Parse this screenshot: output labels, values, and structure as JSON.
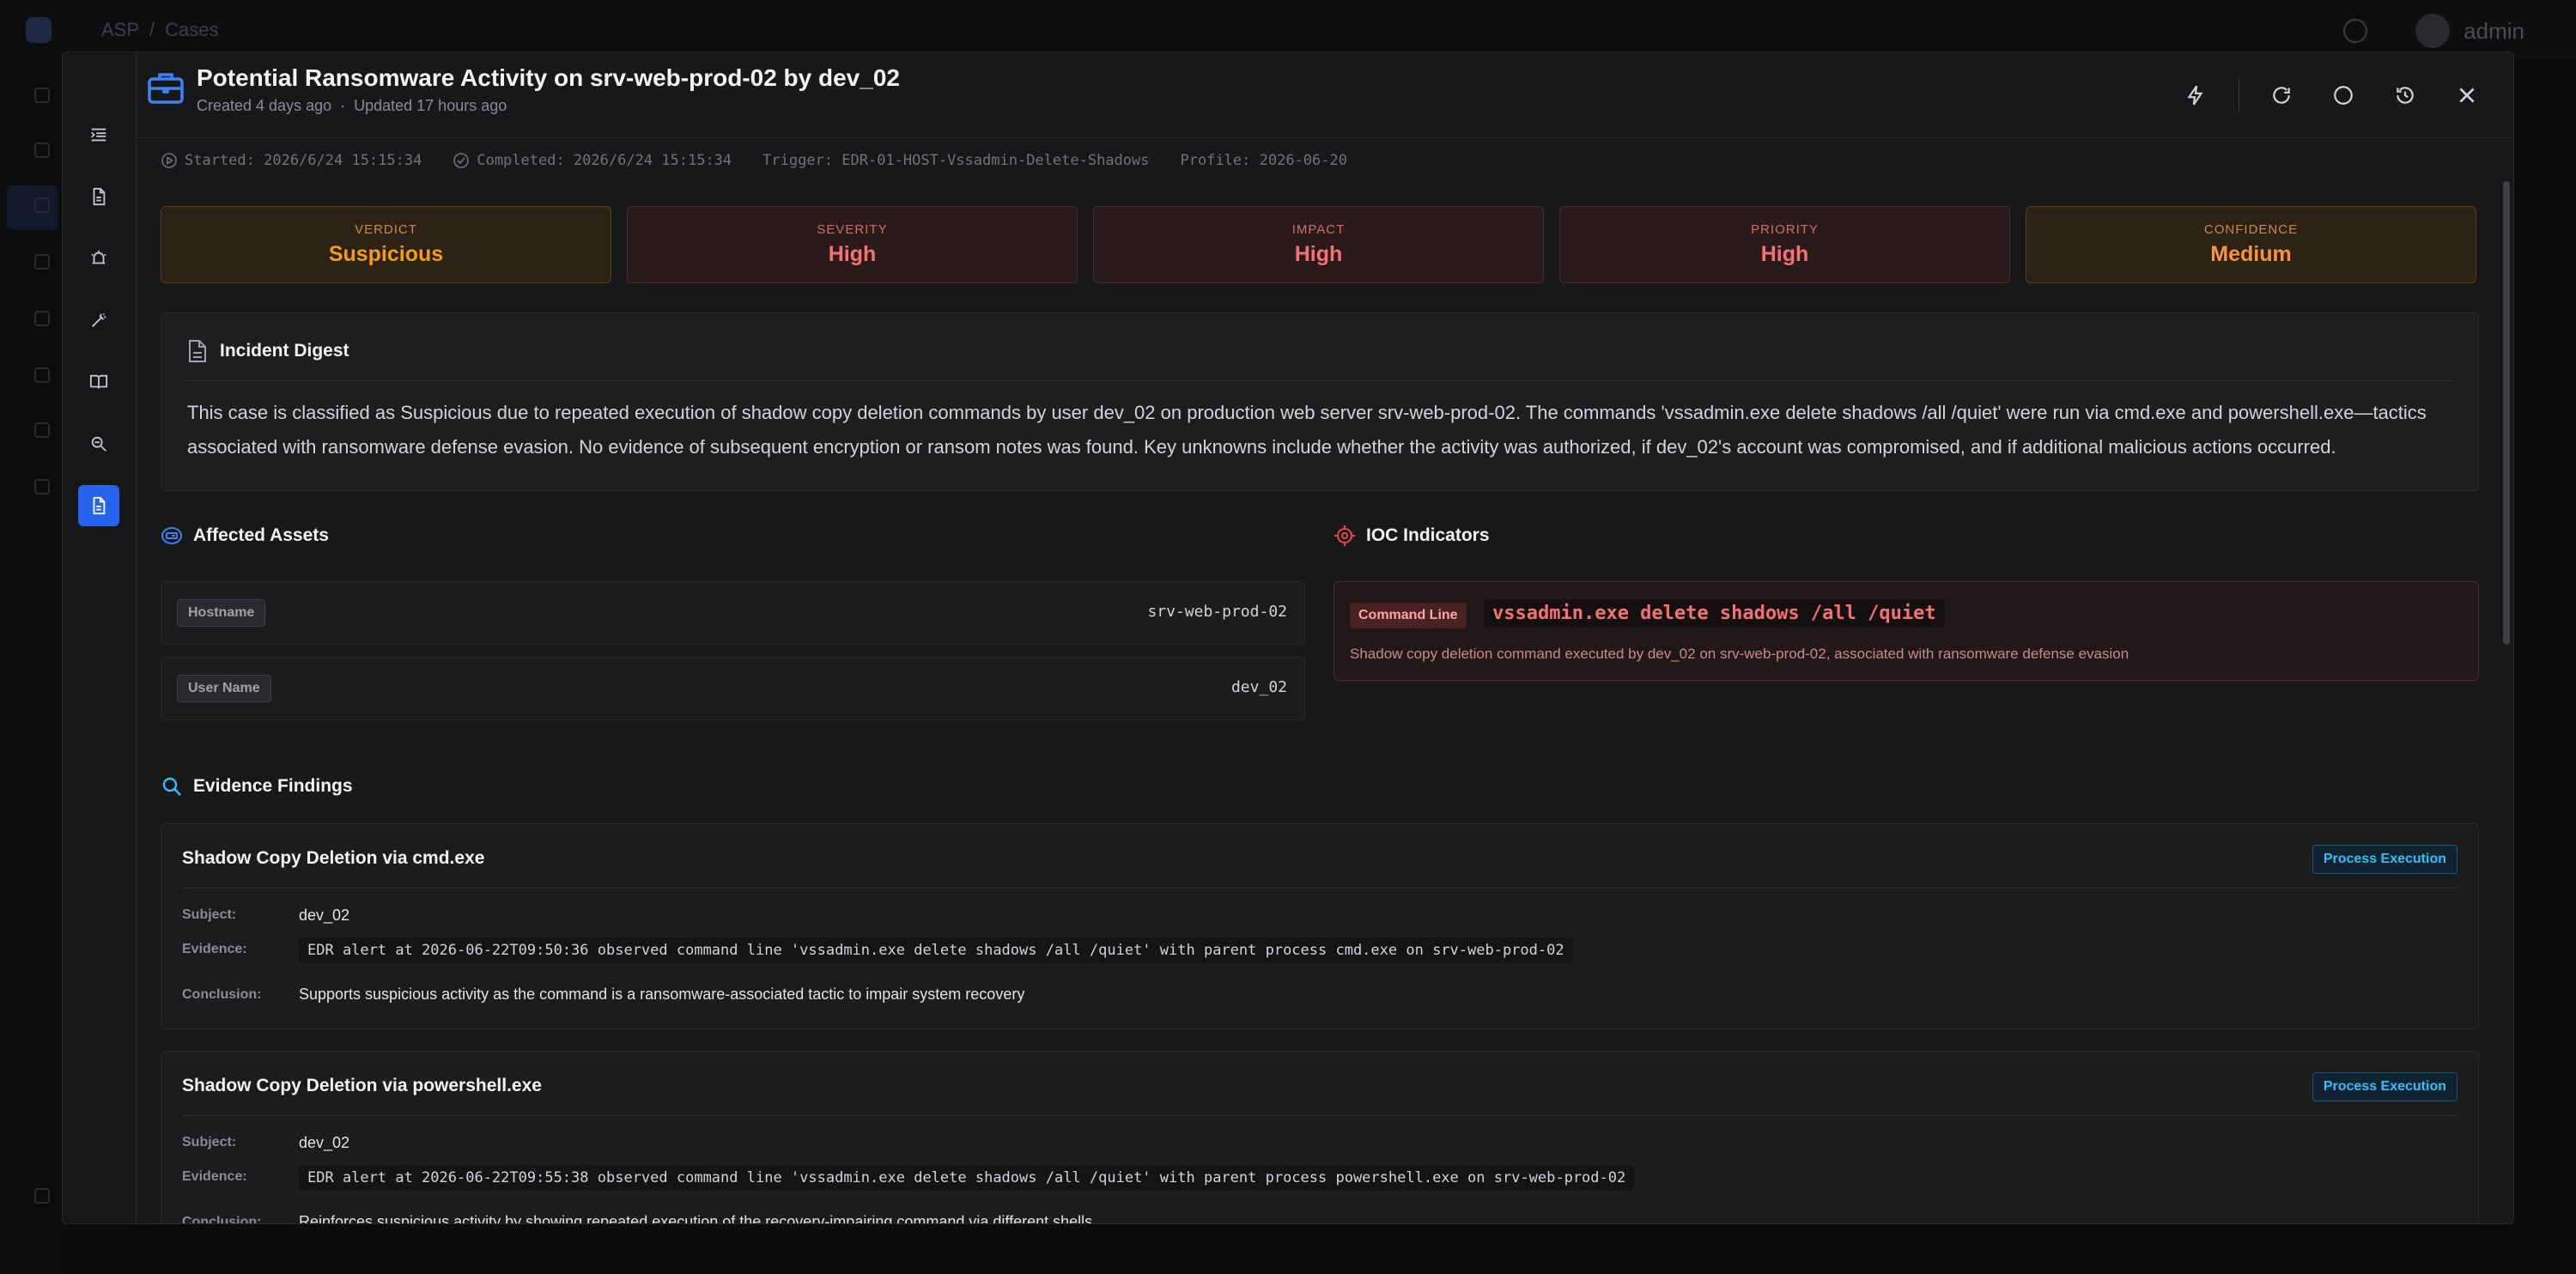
{
  "background": {
    "breadcrumb": [
      "ASP",
      "/",
      "Cases"
    ],
    "user": "admin"
  },
  "header": {
    "title": "Potential Ransomware Activity on srv-web-prod-02 by dev_02",
    "created": "Created 4 days ago",
    "separator": "·",
    "updated": "Updated 17 hours ago"
  },
  "rail": {
    "items": [
      "menu-icon",
      "document-icon",
      "alarm-icon",
      "magic-wand-icon",
      "book-icon",
      "investigate-icon",
      "report-icon"
    ],
    "active": "report-icon"
  },
  "header_actions": [
    "bolt-icon",
    "refresh-icon",
    "comment-icon",
    "history-icon",
    "close-icon"
  ],
  "meta": {
    "started": "Started: 2026/6/24 15:15:34",
    "completed": "Completed: 2026/6/24 15:15:34",
    "trigger": "Trigger: EDR-01-HOST-Vssadmin-Delete-Shadows",
    "profile": "Profile: 2026-06-20"
  },
  "scores": [
    {
      "label": "VERDICT",
      "value": "Suspicious",
      "color": "#f59e0b"
    },
    {
      "label": "SEVERITY",
      "value": "High",
      "color": "#f87171"
    },
    {
      "label": "IMPACT",
      "value": "High",
      "color": "#f87171"
    },
    {
      "label": "PRIORITY",
      "value": "High",
      "color": "#f87171"
    },
    {
      "label": "CONFIDENCE",
      "value": "Medium",
      "color": "#fb923c"
    }
  ],
  "digest": {
    "title": "Incident Digest",
    "text": "This case is classified as Suspicious due to repeated execution of shadow copy deletion commands by user dev_02 on production web server srv-web-prod-02. The commands 'vssadmin.exe delete shadows /all /quiet' were run via cmd.exe and powershell.exe—tactics associated with ransomware defense evasion. No evidence of subsequent encryption or ransom notes was found. Key unknowns include whether the activity was authorized, if dev_02's account was compromised, and if additional malicious actions occurred."
  },
  "assets": {
    "title": "Affected Assets",
    "rows": [
      {
        "key": "Hostname",
        "value": "srv-web-prod-02"
      },
      {
        "key": "User Name",
        "value": "dev_02"
      }
    ]
  },
  "ioc": {
    "title": "IOC Indicators",
    "type": "Command Line",
    "value": "vssadmin.exe delete shadows /all /quiet",
    "description": "Shadow copy deletion command executed by dev_02 on srv-web-prod-02, associated with ransomware defense evasion"
  },
  "evidence": {
    "title": "Evidence Findings",
    "labels": {
      "subject": "Subject:",
      "evidence": "Evidence:",
      "conclusion": "Conclusion:"
    },
    "findings": [
      {
        "title": "Shadow Copy Deletion via cmd.exe",
        "tag": "Process Execution",
        "subject": "dev_02",
        "evidence": "EDR alert at 2026-06-22T09:50:36 observed command line 'vssadmin.exe delete shadows /all /quiet' with parent process cmd.exe on srv-web-prod-02",
        "conclusion": "Supports suspicious activity as the command is a ransomware-associated tactic to impair system recovery"
      },
      {
        "title": "Shadow Copy Deletion via powershell.exe",
        "tag": "Process Execution",
        "subject": "dev_02",
        "evidence": "EDR alert at 2026-06-22T09:55:38 observed command line 'vssadmin.exe delete shadows /all /quiet' with parent process powershell.exe on srv-web-prod-02",
        "conclusion": "Reinforces suspicious activity by showing repeated execution of the recovery-impairing command via different shells"
      }
    ]
  }
}
